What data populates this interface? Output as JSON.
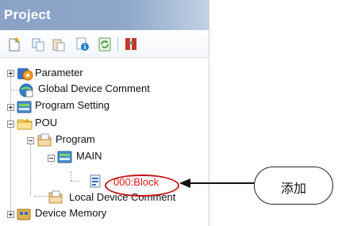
{
  "panel": {
    "title": "Project"
  },
  "toolbar": {
    "buttons": [
      {
        "icon": "new-data-icon"
      },
      {
        "icon": "copy-icon"
      },
      {
        "icon": "paste-icon"
      },
      {
        "icon": "property-icon"
      },
      {
        "icon": "refresh-icon"
      },
      {
        "icon": "search-icon"
      }
    ]
  },
  "tree": {
    "parameter": "Parameter",
    "global_comment": "Global Device Comment",
    "program_setting": "Program Setting",
    "pou": "POU",
    "program": "Program",
    "main": "MAIN",
    "block": "000:Block",
    "local_comment": "Local Device Comment",
    "device_memory": "Device Memory"
  },
  "callout": {
    "text": "添加"
  },
  "colors": {
    "title_bar": "#8ea7ca",
    "highlight_red": "#e5181d",
    "callout_outline": "#c21616"
  }
}
